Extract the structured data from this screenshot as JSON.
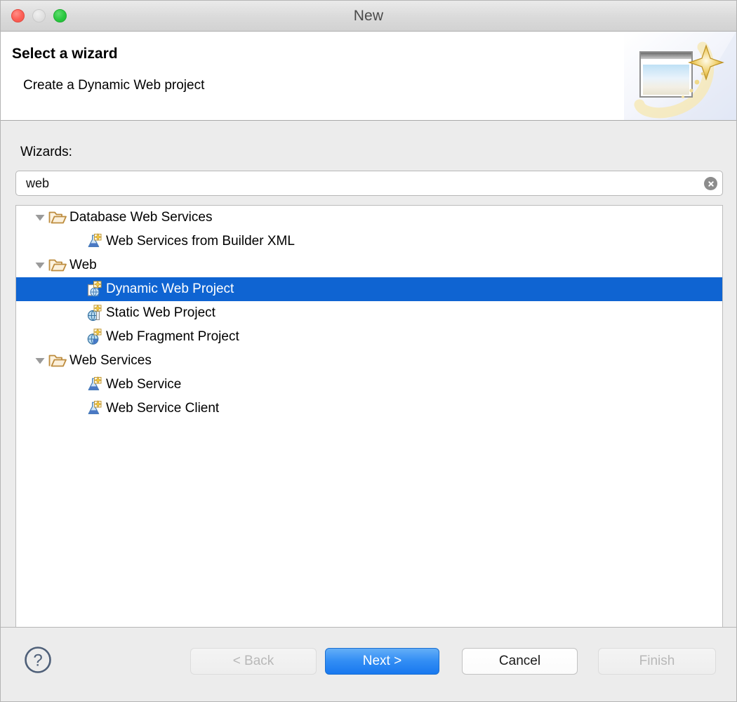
{
  "window": {
    "title": "New",
    "traffic_lights": [
      {
        "name": "close-button",
        "color": "#fd6158"
      },
      {
        "name": "minimize-button",
        "color": "#dddddd"
      },
      {
        "name": "maximize-button",
        "color": "#28c840"
      }
    ]
  },
  "header": {
    "title": "Select a wizard",
    "description": "Create a Dynamic Web project",
    "banner_icon": "wizard-window-sparkle-image"
  },
  "body": {
    "wizards_label": "Wizards:",
    "search": {
      "value": "web",
      "placeholder": "type filter text",
      "clear_icon": "clear-circle-icon"
    },
    "tree": [
      {
        "label": "Database Web Services",
        "level": 0,
        "type": "category",
        "expanded": true,
        "icon": "open-folder-icon",
        "twisty": "triangle-down-icon",
        "selected": false
      },
      {
        "label": "Web Services from Builder XML",
        "level": 1,
        "type": "wizard",
        "icon": "flask-wizard-icon",
        "selected": false
      },
      {
        "label": "Web",
        "level": 0,
        "type": "category",
        "expanded": true,
        "icon": "open-folder-icon",
        "twisty": "triangle-down-icon",
        "selected": false
      },
      {
        "label": "Dynamic Web Project",
        "level": 1,
        "type": "wizard",
        "icon": "dynamic-web-project-icon",
        "selected": true
      },
      {
        "label": "Static Web Project",
        "level": 1,
        "type": "wizard",
        "icon": "static-web-project-icon",
        "selected": false
      },
      {
        "label": "Web Fragment Project",
        "level": 1,
        "type": "wizard",
        "icon": "web-fragment-project-icon",
        "selected": false
      },
      {
        "label": "Web Services",
        "level": 0,
        "type": "category",
        "expanded": true,
        "icon": "open-folder-icon",
        "twisty": "triangle-down-icon",
        "selected": false
      },
      {
        "label": "Web Service",
        "level": 1,
        "type": "wizard",
        "icon": "flask-wizard-icon",
        "selected": false
      },
      {
        "label": "Web Service Client",
        "level": 1,
        "type": "wizard",
        "icon": "flask-wizard-icon",
        "selected": false
      }
    ]
  },
  "footer": {
    "help_icon": "help-question-icon",
    "buttons": [
      {
        "id": "back",
        "label": "< Back",
        "state": "disabled"
      },
      {
        "id": "next",
        "label": "Next >",
        "state": "primary"
      },
      {
        "id": "cancel",
        "label": "Cancel",
        "state": "normal"
      },
      {
        "id": "finish",
        "label": "Finish",
        "state": "disabled"
      }
    ]
  },
  "colors": {
    "selection_blue": "#0f64d2",
    "primary_button_blue": "#1878ef",
    "dialog_background": "#ececec",
    "folder_gold": "#c08b3e",
    "star_gold": "#e8b221"
  }
}
